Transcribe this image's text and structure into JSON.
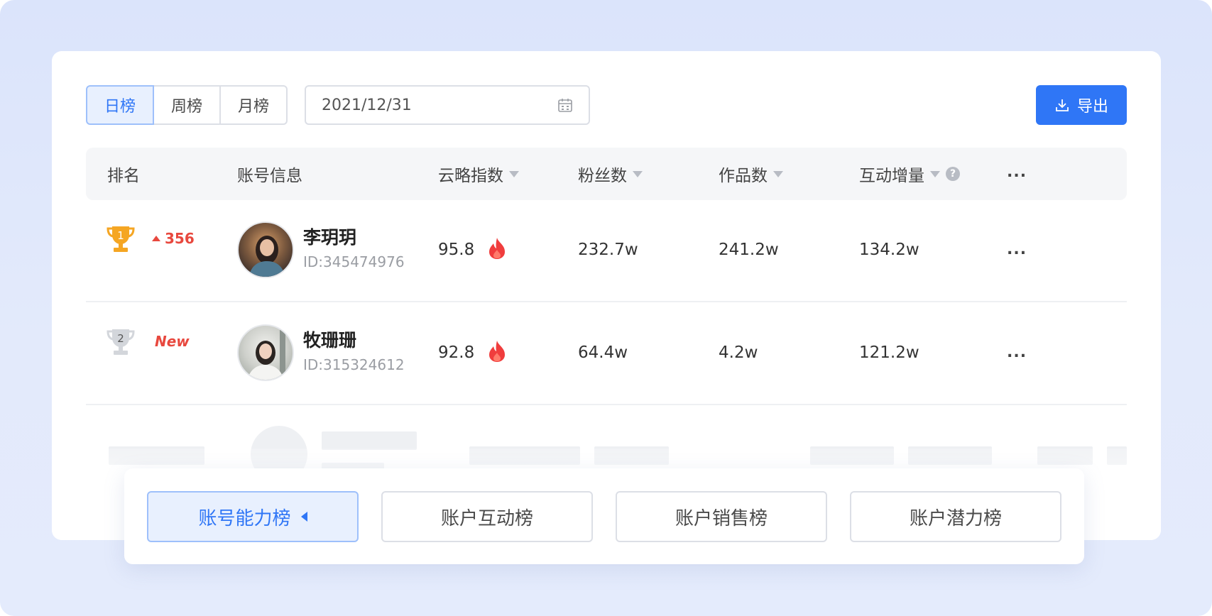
{
  "filters": {
    "periods": [
      {
        "label": "日榜",
        "active": true
      },
      {
        "label": "周榜",
        "active": false
      },
      {
        "label": "月榜",
        "active": false
      }
    ],
    "date_value": "2021/12/31",
    "calendar_icon": "calendar-icon"
  },
  "toolbar": {
    "export_label": "导出",
    "export_icon": "download-icon"
  },
  "table": {
    "headers": {
      "rank": "排名",
      "account": "账号信息",
      "index": "云略指数",
      "fans": "粉丝数",
      "works": "作品数",
      "interaction": "互动增量",
      "more": "..."
    },
    "rows": [
      {
        "rank": "1",
        "rank_change": "356",
        "name": "李玥玥",
        "id": "ID:345474976",
        "index": "95.8",
        "fans": "232.7w",
        "works": "241.2w",
        "interaction": "134.2w",
        "more": "..."
      },
      {
        "rank": "2",
        "rank_change": "New",
        "name": "牧珊珊",
        "id": "ID:315324612",
        "index": "92.8",
        "fans": "64.4w",
        "works": "4.2w",
        "interaction": "121.2w",
        "more": "..."
      }
    ]
  },
  "boards": [
    {
      "label": "账号能力榜",
      "active": true
    },
    {
      "label": "账户互动榜",
      "active": false
    },
    {
      "label": "账户销售榜",
      "active": false
    },
    {
      "label": "账户潜力榜",
      "active": false
    }
  ],
  "colors": {
    "accent": "#2f76f6",
    "rank_up": "#e8483e",
    "gold": "#f5a623",
    "silver": "#c9cdd3"
  }
}
